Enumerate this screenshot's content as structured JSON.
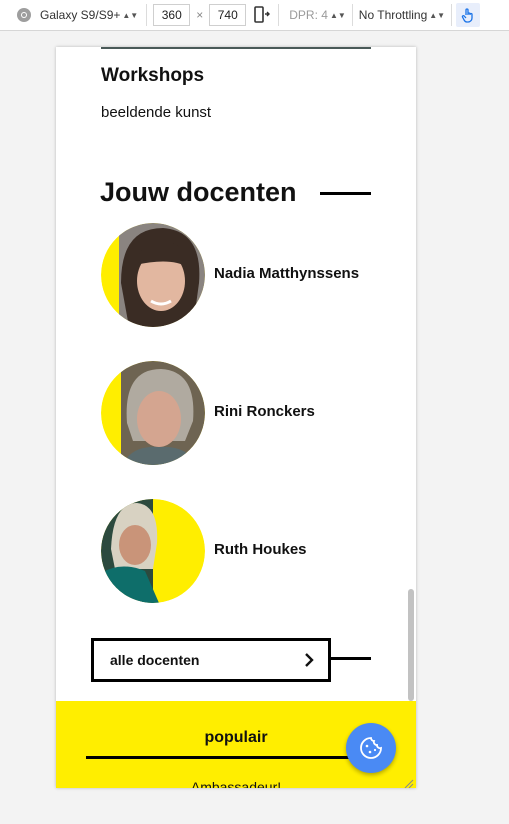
{
  "devtools": {
    "device": "Galaxy S9/S9+",
    "width": "360",
    "times": "×",
    "height": "740",
    "dpr": "DPR: 4",
    "throttling": "No Throttling"
  },
  "page": {
    "workshops_title": "Workshops",
    "workshops_subtitle": "beeldende kunst",
    "section_title": "Jouw docenten",
    "teachers": [
      {
        "name": "Nadia Matthynssens"
      },
      {
        "name": "Rini Ronckers"
      },
      {
        "name": "Ruth Houkes"
      }
    ],
    "all_teachers_label": "alle docenten"
  },
  "footer": {
    "popular": "populair",
    "ambassador": "Ambassadeur!"
  },
  "colors": {
    "accent_yellow": "#ffee00",
    "cookie_blue": "#4a8af4"
  }
}
